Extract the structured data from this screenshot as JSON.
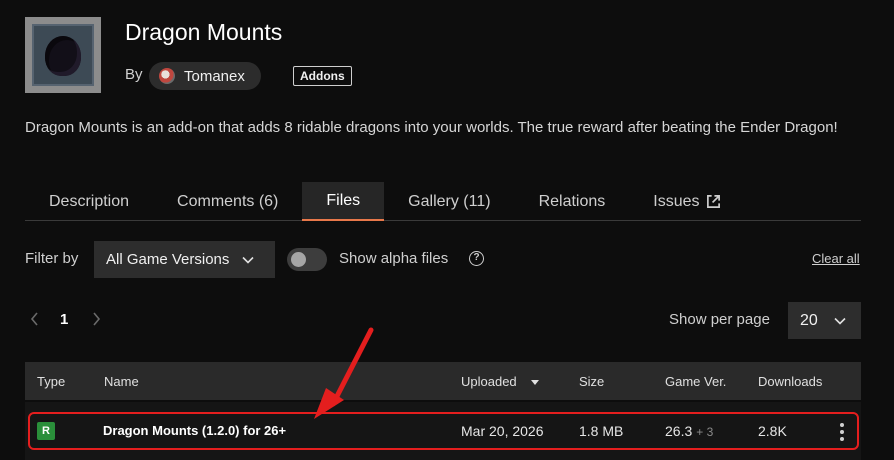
{
  "project": {
    "title": "Dragon Mounts",
    "by_label": "By",
    "author": "Tomanex",
    "category_badge": "Addons",
    "description": "Dragon Mounts is an add-on that adds 8 ridable dragons into your worlds. The true reward after beating the Ender Dragon!"
  },
  "tabs": [
    {
      "label": "Description",
      "active": false
    },
    {
      "label": "Comments (6)",
      "active": false
    },
    {
      "label": "Files",
      "active": true
    },
    {
      "label": "Gallery (11)",
      "active": false
    },
    {
      "label": "Relations",
      "active": false
    },
    {
      "label": "Issues",
      "active": false,
      "icon": "external-link-icon"
    }
  ],
  "filters": {
    "filter_label": "Filter by",
    "game_version_selected": "All Game Versions",
    "show_alpha_label": "Show alpha files",
    "show_alpha_enabled": false,
    "clear_all": "Clear all"
  },
  "pagination": {
    "current_page": "1",
    "per_page_label": "Show per page",
    "per_page_selected": "20"
  },
  "table": {
    "columns": [
      "Type",
      "Name",
      "Uploaded",
      "Size",
      "Game Ver.",
      "Downloads"
    ],
    "sorted_column": "Uploaded",
    "rows": [
      {
        "type": "R",
        "name": "Dragon Mounts (1.2.0) for 26+",
        "uploaded": "Mar 20, 2026",
        "size": "1.8 MB",
        "game_version": "26.3",
        "game_version_more": "+ 3",
        "downloads": "2.8K"
      }
    ]
  },
  "colors": {
    "accent_tab_underline": "#e8784a",
    "release_badge": "#2a8f3a",
    "annotation_red": "#e41e1e"
  }
}
